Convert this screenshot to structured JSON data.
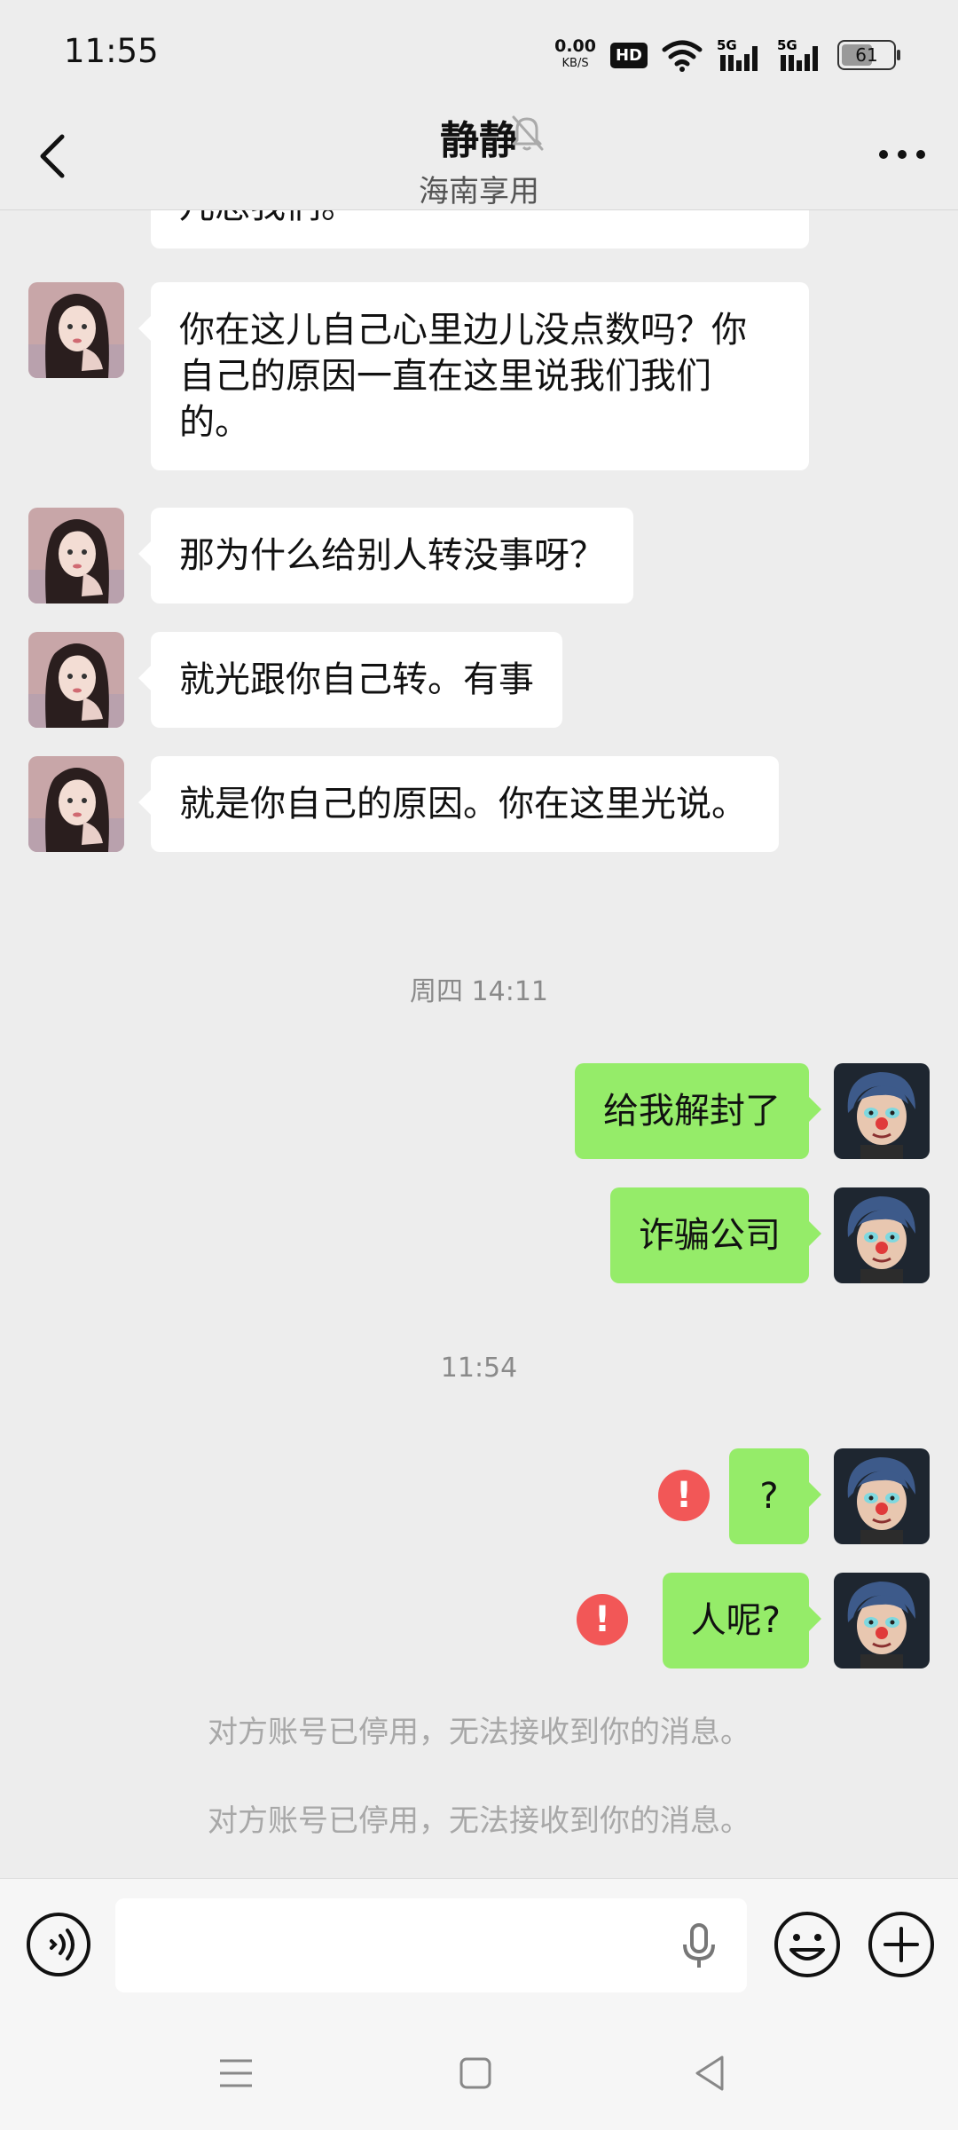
{
  "status_bar": {
    "time": "11:55",
    "net_speed": "0.00",
    "net_unit": "KB/S",
    "hd_badge": "HD",
    "sig1": "5G",
    "sig2": "5G",
    "battery": "61"
  },
  "header": {
    "title": "静静",
    "subtitle": "海南享用"
  },
  "messages": {
    "m0": "儿总我们。",
    "m1": "你在这儿自己心里边儿没点数吗？你自己的原因一直在这里说我们我们的。",
    "m2": "那为什么给别人转没事呀？",
    "m3": "就光跟你自己转。有事",
    "m4": "就是你自己的原因。你在这里光说。",
    "ts1": "周四 14:11",
    "m5": "给我解封了",
    "m6": "诈骗公司",
    "ts2": "11:54",
    "m7": "?",
    "m8": "人呢?",
    "error_mark": "!",
    "sys1": "对方账号已停用，无法接收到你的消息。",
    "sys2": "对方账号已停用，无法接收到你的消息。"
  },
  "colors": {
    "outgoing_bubble": "#95ec69",
    "incoming_bubble": "#ffffff",
    "error": "#f25757",
    "background": "#ededed"
  }
}
